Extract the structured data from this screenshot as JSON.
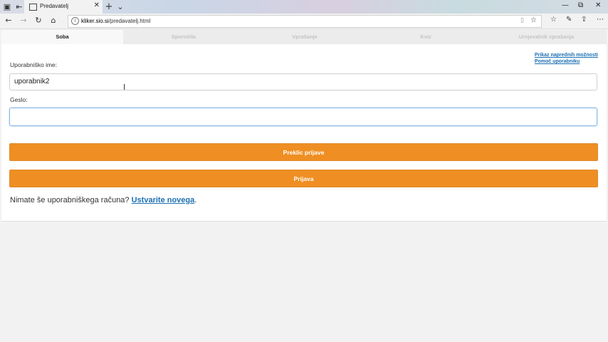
{
  "browser": {
    "tab_title": "Predavatelj",
    "url_domain": "kliker.sio.si",
    "url_path": "/predavatelj.html"
  },
  "app_tabs": [
    {
      "label": "Soba",
      "active": true
    },
    {
      "label": "Sporočila",
      "active": false
    },
    {
      "label": "Vprašanje",
      "active": false
    },
    {
      "label": "Kviz",
      "active": false
    },
    {
      "label": "Urejevalnik vprašanja",
      "active": false
    }
  ],
  "links": {
    "advanced": "Prikaz naprednih možnosti",
    "help": "Pomoč uporabniku"
  },
  "form": {
    "username_label": "Uporabniško ime:",
    "username_value": "uporabnik2",
    "password_label": "Geslo:",
    "password_value": "",
    "cancel_button": "Preklic prijave",
    "login_button": "Prijava"
  },
  "signup": {
    "text": "Nimate še uporabniškega računa?",
    "link": "Ustvarite novega",
    "period": "."
  },
  "colors": {
    "accent": "#ef8f23",
    "link": "#1b6fb3"
  }
}
